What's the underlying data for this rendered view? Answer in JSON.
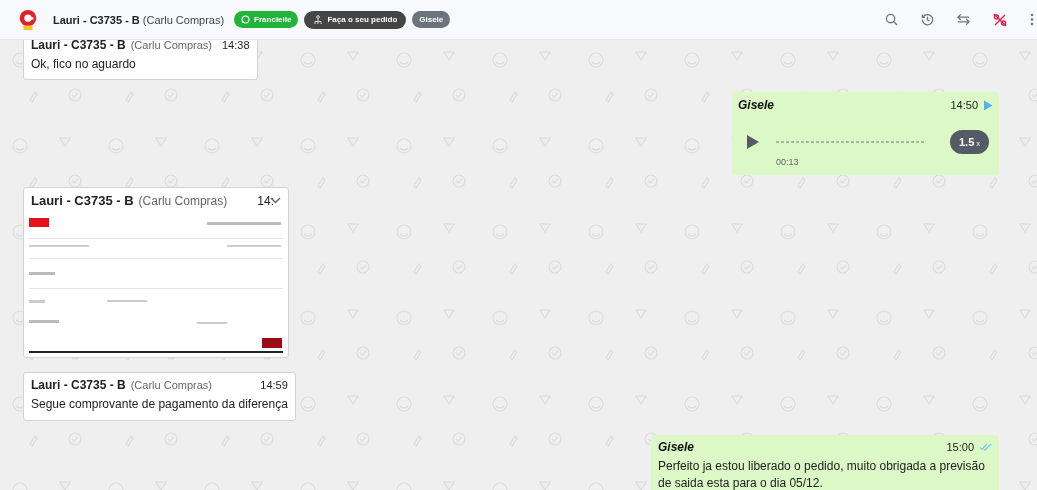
{
  "header": {
    "contact": "Lauri - C3735 - B",
    "company": "(Carlu Compras)",
    "badges": [
      {
        "kind": "whatsapp",
        "label": "Francielle"
      },
      {
        "kind": "flow",
        "label": "Faça o seu pedido"
      },
      {
        "kind": "plain",
        "label": "Gisele"
      }
    ]
  },
  "messages": [
    {
      "kind": "text",
      "outgoing": false,
      "sender": "Lauri - C3735 - B",
      "company": "(Carlu Compras)",
      "time": "14:38",
      "text": "Ok, fico no aguardo"
    },
    {
      "kind": "audio",
      "outgoing": true,
      "sender": "Gisele",
      "time": "14:50",
      "played": true,
      "duration": "00:13",
      "speed": "1.5",
      "speed_unit": "x"
    },
    {
      "outgoing": false,
      "sender": "Lauri - C3735 - B",
      "company": "(Carlu Compras)",
      "time": "14:"
    },
    {
      "kind": "text",
      "outgoing": false,
      "sender": "Lauri - C3735 - B",
      "company": "(Carlu Compras)",
      "time": "14:59",
      "text": "Segue comprovante de pagamento da diferença"
    },
    {
      "kind": "text",
      "outgoing": true,
      "sender": "Gisele",
      "time": "15:00",
      "read": true,
      "text": "Perfeito ja estou liberado o pedido, muito obrigada a previsão de saida esta para o dia 05/12."
    }
  ]
}
